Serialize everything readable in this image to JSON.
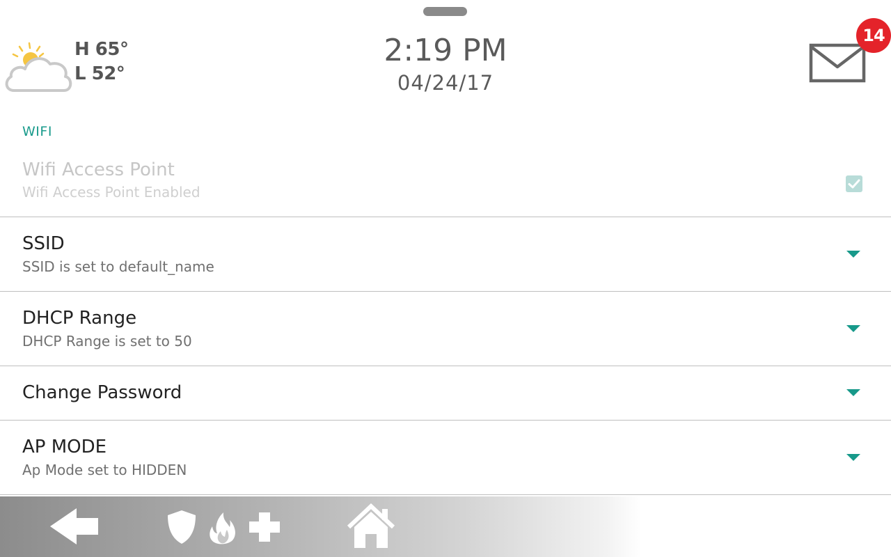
{
  "header": {
    "weather": {
      "icon": "partly-cloudy-icon",
      "high": "H 65°",
      "low": "L 52°"
    },
    "time": "2:19 PM",
    "date": "04/24/17",
    "messages": {
      "icon": "mail-icon",
      "count": "14"
    }
  },
  "section": {
    "title": "WIFI"
  },
  "settings": [
    {
      "title": "Wifi Access Point",
      "subtitle": "Wifi Access Point Enabled",
      "control": "checkbox",
      "checked": true,
      "enabled": false
    },
    {
      "title": "SSID",
      "subtitle": "SSID is set to default_name",
      "control": "dropdown"
    },
    {
      "title": "DHCP Range",
      "subtitle": "DHCP Range is set to 50",
      "control": "dropdown"
    },
    {
      "title": "Change Password",
      "subtitle": "",
      "control": "dropdown"
    },
    {
      "title": "AP MODE",
      "subtitle": "Ap Mode set to HIDDEN",
      "control": "dropdown"
    }
  ],
  "bottom_nav": {
    "items": [
      "back-arrow-icon",
      "shield-icon",
      "fire-icon",
      "medical-cross-icon",
      "home-icon"
    ]
  },
  "colors": {
    "accent": "#17998a",
    "badge": "#e4232a",
    "text_primary": "#222222",
    "text_secondary": "#707070",
    "sun": "#f5c542"
  }
}
